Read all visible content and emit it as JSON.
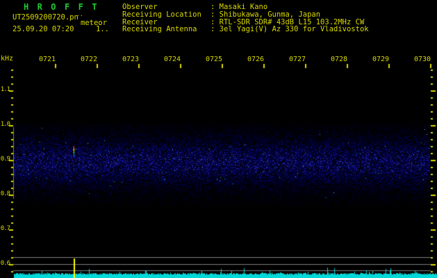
{
  "header": {
    "title": "H R O F F T",
    "file_label": "UT2509200720.pn",
    "file_dots": "..",
    "station_label": "meteor",
    "datetime": "25.09.20 07:20",
    "counter": "1..",
    "info_rows": [
      {
        "label": "Observer",
        "sep": ": ",
        "value": "Masaki Kano"
      },
      {
        "label": "Receiving Location",
        "sep": ": ",
        "value": "Shibukawa, Gunma, Japan"
      },
      {
        "label": "Receiver",
        "sep": ": ",
        "value": "RTL-SDR SDR# 43dB L15 103.2MHz CW"
      },
      {
        "label": "Receiving Antenna",
        "sep": ": ",
        "value": "3el Yagi(V) Az 330 for Vladivostok"
      }
    ]
  },
  "axes": {
    "y_unit": "kHz",
    "y_tick_labels": [
      "1.1",
      "1.0",
      "0.9",
      "0.8",
      "0.7",
      "0.6"
    ],
    "x_tick_labels": [
      "0721",
      "0722",
      "0723",
      "0724",
      "0725",
      "0726",
      "0727",
      "0728",
      "0729",
      "0730"
    ]
  },
  "chart_data": {
    "type": "heatmap",
    "title": "HROFFT meteor-scatter radio spectrogram, 10-minute strip",
    "time_range_ut": [
      "0720",
      "0730"
    ],
    "x_tick_labels": [
      "0721",
      "0722",
      "0723",
      "0724",
      "0725",
      "0726",
      "0727",
      "0728",
      "0729",
      "0730"
    ],
    "y_unit": "kHz",
    "y_tick_labels": [
      "1.1",
      "1.0",
      "0.9",
      "0.8",
      "0.7",
      "0.6"
    ],
    "y_minor_step_khz": 0.02,
    "noise_band": {
      "freq_low_khz": 0.8,
      "freq_high_khz": 1.0,
      "center_khz": 0.9,
      "description": "continuous random dark-blue noise speckle band across full 10 minutes"
    },
    "echoes": [
      {
        "time_ut": "0721:25",
        "freq_khz": 0.93,
        "kind": "meteor echo ping",
        "colors_top_to_bottom": [
          "red",
          "orange",
          "yellow",
          "green",
          "cyan",
          "blue"
        ]
      }
    ],
    "reference_lines_khz": [
      0.62,
      0.6,
      0.58
    ],
    "signal_level_trace": {
      "position": "bottom strip",
      "color": "cyan",
      "description": "jagged noise-level trace with solid baseline",
      "spikes": [
        {
          "time_ut": "0721:25",
          "color": "yellow"
        }
      ]
    },
    "legend": "none",
    "grid": "off"
  },
  "colors": {
    "background": "#000000",
    "text_yellow": "#d9d900",
    "title_green": "#22cc33",
    "grid_gray": "#7e7e7e",
    "trace_cyan": "#00d8d8",
    "spike_yellow": "#ffff00"
  }
}
